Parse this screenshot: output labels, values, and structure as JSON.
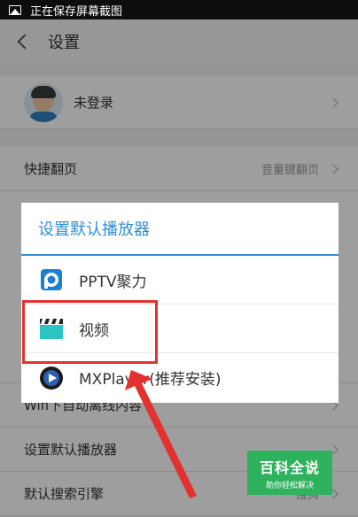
{
  "status_bar": {
    "text": "正在保存屏幕截图",
    "icon": "image-icon"
  },
  "header": {
    "title": "设置",
    "back_icon": "back-arrow-icon"
  },
  "account": {
    "label": "未登录"
  },
  "settings": [
    {
      "label": "快捷翻页",
      "value": "音量键翻页"
    },
    {
      "label": "Wifi下自动离线内容",
      "value": ""
    },
    {
      "label": "设置默认播放器",
      "value": ""
    },
    {
      "label": "默认搜索引擎",
      "value": "搜狗"
    }
  ],
  "dialog": {
    "title": "设置默认播放器",
    "options": [
      {
        "label": "PPTV聚力",
        "icon": "pptv-icon"
      },
      {
        "label": "视频",
        "icon": "video-clapper-icon"
      },
      {
        "label": "MXPlayer(推荐安装)",
        "icon": "mxplayer-icon"
      }
    ]
  },
  "watermark": {
    "line1": "百科全说",
    "line2": "助你轻松解决"
  },
  "colors": {
    "accent": "#2f8fd6",
    "highlight": "#e2322f",
    "watermark": "#2fb25d"
  }
}
